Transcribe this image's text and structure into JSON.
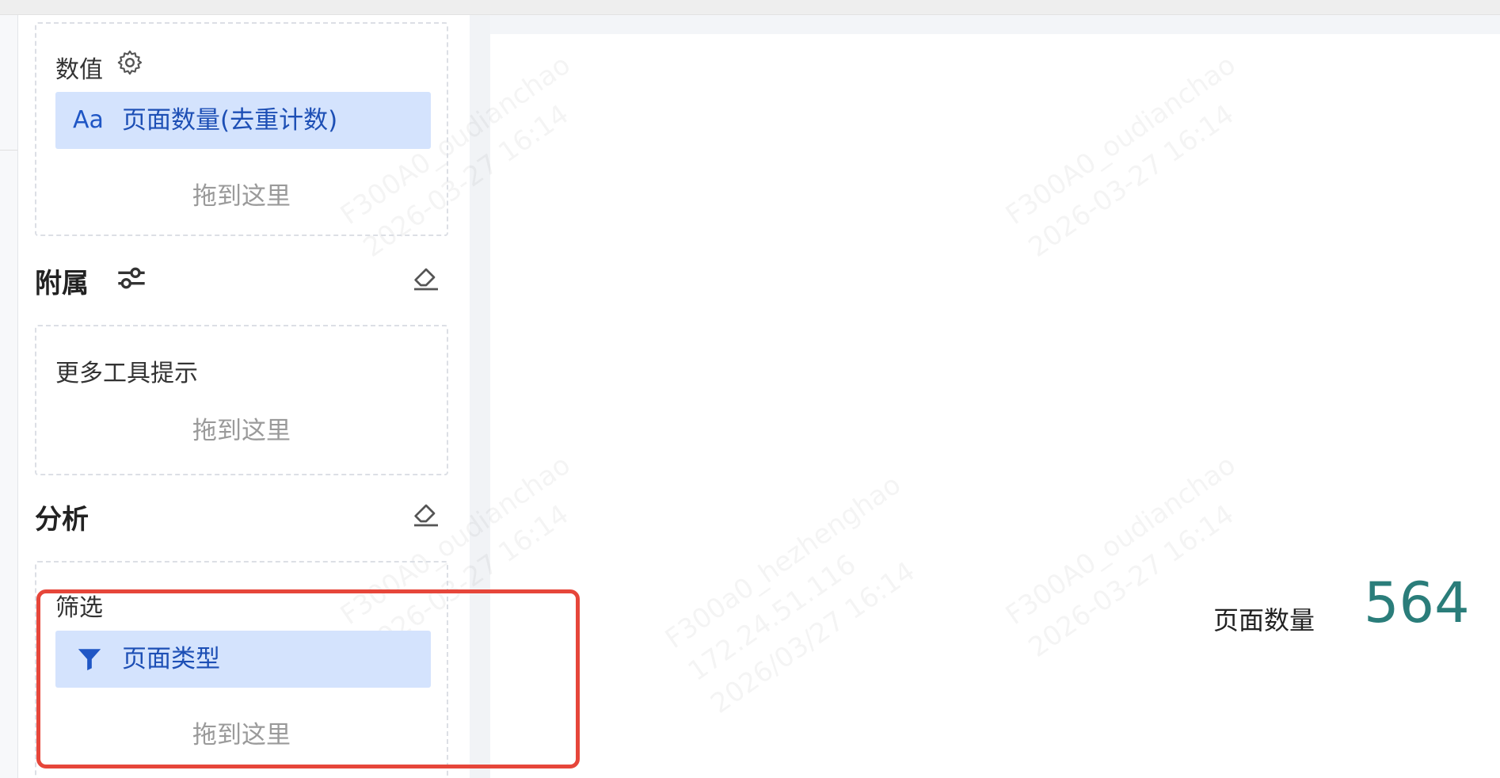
{
  "fields": {
    "values_section": {
      "label": "数值",
      "chip_icon": "Aa",
      "chip_label": "页面数量(去重计数)",
      "drop_hint": "拖到这里"
    },
    "attached_section": {
      "title": "附属",
      "tooltip_label": "更多工具提示",
      "drop_hint": "拖到这里"
    },
    "analysis_section": {
      "title": "分析",
      "filter_label": "筛选",
      "chip_label": "页面类型",
      "drop_hint": "拖到这里"
    }
  },
  "kpi": {
    "label": "页面数量",
    "value": "564",
    "value_color": "#2a7d7a"
  },
  "highlight_color": "#e6463a",
  "chip_color": "#d4e3fd"
}
